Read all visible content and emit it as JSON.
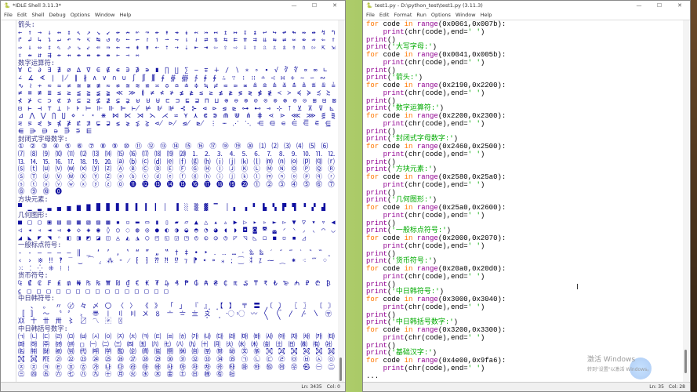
{
  "shell": {
    "title": "*IDLE Shell 3.11.3*",
    "menu": [
      "File",
      "Edit",
      "Shell",
      "Debug",
      "Options",
      "Window",
      "Help"
    ],
    "sections": [
      {
        "header": "箭头:",
        "chars": "← ↑ → ↓ ↔ ↕ ↖ ↗ ↘ ↙ ↚ ↛ ↜ ↝ ↞ ↟ ↠ ↡ ↢ ↣ ↤ ↥ ↦ ↧ ↨ ↩ ↪ ↫ ↬ ↭ ↮ ↯ ↰ ↱ ↲ ↳ ↴ ↵ ↶ ↷ ↸ ↹ ↺ ↻ ↼ ↽ ↾ ↿ ⇀ ⇁ ⇂ ⇃ ⇄ ⇅ ⇆ ⇇ ⇈ ⇉ ⇊ ⇋ ⇌ ⇍ ⇎ ⇏ ⇐ ⇑ ⇒ ⇓ ⇔ ⇕ ⇖ ⇗ ⇘ ⇙ ⇚ ⇛ ⇜ ⇝ ⇞ ⇟ ⇠ ⇡ ⇢ ⇣ ⇤ ⇥ ⇦ ⇧ ⇨ ⇩ ⇪ ⇫ ⇬ ⇭ ⇮ ⇯ ⇰ ⇱ ⇲ ⇳ ⇴ ⇵ ⇶ ⇷ ⇸ ⇹ ⇺ ⇻ ⇼ ⇽ ⇾ ⇿"
      },
      {
        "header": "数字运算符:",
        "chars": "∀ ∁ ∂ ∃ ∄ ∅ ∆ ∇ ∈ ∉ ∊ ∋ ∌ ∍ ∎ ∏ ∐ ∑ − ∓ ∔ ∕ ∖ ∗ ∘ ∙ √ ∛ ∜ ∝ ∞ ∟ ∠ ∡ ∢ ∣ ∤ ∥ ∦ ∧ ∨ ∩ ∪ ∫ ∬ ∭ ∮ ∯ ∰ ∱ ∲ ∳ ∴ ∵ ∶ ∷ ∸ ∹ ∺ ∻ ∼ ∽ ∾ ∿ ≀ ≁ ≂ ≃ ≄ ≅ ≆ ≇ ≈ ≉ ≊ ≋ ≌ ≍ ≎ ≏ ≐ ≑ ≒ ≓ ≔ ≕ ≖ ≗ ≘ ≙ ≚ ≛ ≜ ≝ ≞ ≟ ≠ ≡ ≢ ≣ ≤ ≥ ≦ ≧ ≨ ≩ ≪ ≫ ≬ ≭ ≮ ≯ ≰ ≱ ≲ ≳ ≴ ≵ ≶ ≷ ≸ ≹ ≺ ≻ ≼ ≽ ≾ ≿ ⊀ ⊁ ⊂ ⊃ ⊄ ⊅ ⊆ ⊇ ⊈ ⊉ ⊊ ⊋ ⊌ ⊍ ⊎ ⊏ ⊐ ⊑ ⊒ ⊓ ⊔ ⊕ ⊖ ⊗ ⊘ ⊙ ⊚ ⊛ ⊜ ⊝ ⊞ ⊟ ⊠ ⊡ ⊢ ⊣ ⊤ ⊥ ⊦ ⊧ ⊨ ⊩ ⊪ ⊫ ⊬ ⊭ ⊮ ⊯ ⊰ ⊱ ⊲ ⊳ ⊴ ⊵ ⊶ ⊷ ⊸ ⊹ ⊺ ⊻ ⊼ ⊽ ⊾ ⊿ ⋀ ⋁ ⋂ ⋃ ⋄ ⋅ ⋆ ⋇ ⋈ ⋉ ⋊ ⋋ ⋌ ⋍ ⋎ ⋏ ⋐ ⋑ ⋒ ⋓ ⋔ ⋕ ⋖ ⋗ ⋘ ⋙ ⋚ ⋛ ⋜ ⋝ ⋞ ⋟ ⋠ ⋡ ⋢ ⋣ ⋤ ⋥ ⋦ ⋧ ⋨ ⋩ ⋪ ⋫ ⋬ ⋭ ⋮ ⋯ ⋰ ⋱ ⋲ ⋳ ⋴ ⋵ ⋶ ⋷ ⋸ ⋹ ⋺ ⋻ ⋼ ⋽ ⋾ ⋿"
      },
      {
        "header": "封闭式字母数字:",
        "chars": "① ② ③ ④ ⑤ ⑥ ⑦ ⑧ ⑨ ⑩ ⑪ ⑫ ⑬ ⑭ ⑮ ⑯ ⑰ ⑱ ⑲ ⑳ ⑴ ⑵ ⑶ ⑷ ⑸ ⑹ ⑺ ⑻ ⑼ ⑽ ⑾ ⑿ ⒀ ⒁ ⒂ ⒃ ⒄ ⒅ ⒆ ⒇ ⒈ ⒉ ⒊ ⒋ ⒌ ⒍ ⒎ ⒏ ⒐ ⒑ ⒒ ⒓ ⒔ ⒕ ⒖ ⒗ ⒘ ⒙ ⒚ ⒛ ⒜ ⒝ ⒞ ⒟ ⒠ ⒡ ⒢ ⒣ ⒤ ⒥ ⒦ ⒧ ⒨ ⒩ ⒪ ⒫ ⒬ ⒭ ⒮ ⒯ ⒰ ⒱ ⒲ ⒳ ⒴ ⒵ Ⓐ Ⓑ Ⓒ Ⓓ Ⓔ Ⓕ Ⓖ Ⓗ Ⓘ Ⓙ Ⓚ Ⓛ Ⓜ Ⓝ Ⓞ Ⓟ Ⓠ Ⓡ Ⓢ Ⓣ Ⓤ Ⓥ Ⓦ Ⓧ Ⓨ Ⓩ ⓐ ⓑ ⓒ ⓓ ⓔ ⓕ ⓖ ⓗ ⓘ ⓙ ⓚ ⓛ ⓜ ⓝ ⓞ ⓟ ⓠ ⓡ ⓢ ⓣ ⓤ ⓥ ⓦ ⓧ ⓨ ⓩ ⓪ ⓫ ⓬ ⓭ ⓮ ⓯ ⓰ ⓱ ⓲ ⓳ ⓴ ⓵ ⓶ ⓷ ⓸ ⓹ ⓺ ⓻ ⓼ ⓽ ⓾ ⓿"
      },
      {
        "header": "方块元素:",
        "chars": "▀ ▁ ▂ ▃ ▄ ▅ ▆ ▇ █ ▉ ▊ ▋ ▌ ▍ ▎ ▏ ▐ ░ ▒ ▓ ▔ ▕ ▖ ▗ ▘ ▙ ▚ ▛ ▜ ▝ ▞ ▟"
      },
      {
        "header": "几何图形:",
        "chars": "■ □ ▢ ▣ ▤ ▥ ▦ ▧ ▨ ▩ ▪ ▫ ▬ ▭ ▮ ▯ ▰ ▱ ▲ △ ▴ ▵ ▶ ▷ ▸ ▹ ► ▻ ▼ ▽ ▾ ▿ ◀ ◁ ◂ ◃ ◄ ◅ ◆ ◇ ◈ ◉ ◊ ○ ◌ ◍ ◎ ● ◐ ◑ ◒ ◓ ◔ ◕ ◖ ◗ ◘ ◙ ◚ ◛ ◜ ◝ ◞ ◟ ◠ ◡ ◢ ◣ ◤ ◥ ◦ ◧ ◨ ◩ ◪ ◫ ◬ ◭ ◮ ◯ ◰ ◱ ◲ ◳ ◴ ◵ ◶ ◷ ◸ ◹ ◺ ◻ ◼ ◽ ◾ ◿"
      },
      {
        "header": "一般标点符号:",
        "chars": "‐ ‑ ‒ – — ― ‖ ‗ ‘ ’ ‚ ‛ “ ” „ ‟ † ‡ • ‣ ․ ‥ … ‧ ‰ ‱ ′ ″ ‴ ‵ ‶ ‷ ‸ ‹ › ※ ‼ ‽ ‾ ‿ ⁀ ⁁ ⁂ ⁃ ⁄ ⁅ ⁆ ⁇ ⁈ ⁉ ⁊ ⁋ ⁌ ⁍ ⁎ ⁏ ⁐ ⁑ ⁒ ⁓ ⁔ ⁕ ⁖ ⁗ ⁘ ⁙ ⁚ ⁛ ⁜ ⁝ ⁞"
      },
      {
        "header": "货币符号:",
        "chars": "₠ ₡ ₢ ₣ ₤ ₥ ₦ ₧ ₨ ₩ ₪ ₫ € ₭ ₮ ₯ ₰ ₱ ₲ ₳ ₴ ₵ ₶ ₷ ₸ ₹ ₺ ₻ ₼ ₽ ₾ ₿ ⃀ □ □ □ □ □ □ □ □ □ □ □ □ □ □ □"
      },
      {
        "header": "中日韩符号:",
        "chars": "　 、 。 〃 〄 々 〆 〇 〈 〉 《 》 「 」 『 』 【 】 〒 〓 〔 〕 〖 〗 〘 〙 〚 〛 〜 〝 〞 〟 〠 〡 〢 〣 〤 〥 〦 〧 〨 〩 〪 〫 〬 〭 〮 〯 〰 〱 〲 〳 〴 〵 〶 〷 〸 〹 〺 〻 〼 〽 〾 〿"
      },
      {
        "header": "中日韩括号数字:",
        "chars": "㈀ ㈁ ㈂ ㈃ ㈄ ㈅ ㈆ ㈇ ㈈ ㈉ ㈊ ㈋ ㈌ ㈍ ㈎ ㈏ ㈐ ㈑ ㈒ ㈓ ㈔ ㈕ ㈖ ㈗ ㈘ ㈙ ㈚ ㈛ ㈜ ㈝ ㈞ □ ㈠ ㈡ ㈢ ㈣ ㈤ ㈥ ㈦ ㈧ ㈨ ㈩ ㈪ ㈫ ㈬ ㈭ ㈮ ㈯ ㈰ ㈱ ㈲ ㈳ ㈴ ㈵ ㈶ ㈷ ㈸ ㈹ ㈺ ㈻ ㈼ ㈽ ㈾ ㈿ ㉀ ㉁ ㉂ ㉃ ㉄ ㉅ ㉆ ㉇ ㉈ ㉉ ㉊ ㉋ ㉌ ㉍ ㉎ ㉏ ㉐ ㉑ ㉒ ㉓ ㉔ ㉕ ㉖ ㉗ ㉘ ㉙ ㉚ ㉛ ㉜ ㉝ ㉞ ㉟ ㉠ ㉡ ㉢ ㉣ ㉤ ㉥ ㉦ ㉧ ㉨ ㉩ ㉪ ㉫ ㉬ ㉭ ㉮ ㉯ ㉰ ㉱ ㉲ ㉳ ㉴ ㉵ ㉶ ㉷ ㉸ ㉹ ㉺ ㉻ ㉼ ㉽ ㉾ ㉿ ㊀ ㊁ ㊂ ㊃ ㊄ ㊅ ㊆ ㊇ ㊈ ㊉ ㊊ ㊋ ㊌ ㊍ ㊎ ㊏ ㊐ ㊑ ㊒ ㊓"
      }
    ],
    "status": {
      "ln": "Ln: 3435",
      "col": "Col: 0"
    }
  },
  "editor": {
    "title": "test1.py - D:\\python_test\\test1.py (3.11.3)",
    "menu": [
      "File",
      "Edit",
      "Format",
      "Run",
      "Options",
      "Window",
      "Help"
    ],
    "blocks": [
      {
        "label": "",
        "start": "0x0061",
        "end": "0x007b"
      },
      {
        "label": "大写字母:",
        "start": "0x0041",
        "end": "0x005b"
      },
      {
        "label": "箭头:",
        "start": "0x2190",
        "end": "0x2200"
      },
      {
        "label": "数字运算符:",
        "start": "0x2200",
        "end": "0x2300"
      },
      {
        "label": "封闭式字母数字:",
        "start": "0x2460",
        "end": "0x2500"
      },
      {
        "label": "方块元素:",
        "start": "0x2580",
        "end": "0x25a0"
      },
      {
        "label": "几何图形:",
        "start": "0x25a0",
        "end": "0x2600"
      },
      {
        "label": "一般标点符号:",
        "start": "0x2000",
        "end": "0x2070"
      },
      {
        "label": "货币符号:",
        "start": "0x20a0",
        "end": "0x20d0"
      },
      {
        "label": "中日韩符号:",
        "start": "0x3000",
        "end": "0x3040"
      },
      {
        "label": "中日韩括号数字:",
        "start": "0x3200",
        "end": "0x3300"
      },
      {
        "label": "基础汉字:",
        "start": "0x4e00",
        "end": "0x9fa6"
      }
    ],
    "trailing": "...",
    "status": {
      "ln": "Ln: 35",
      "col": "Col: 28"
    }
  },
  "watermark": {
    "line1": "激活 Windows",
    "line2": "转到\"设置\"以激活 Windows。"
  }
}
